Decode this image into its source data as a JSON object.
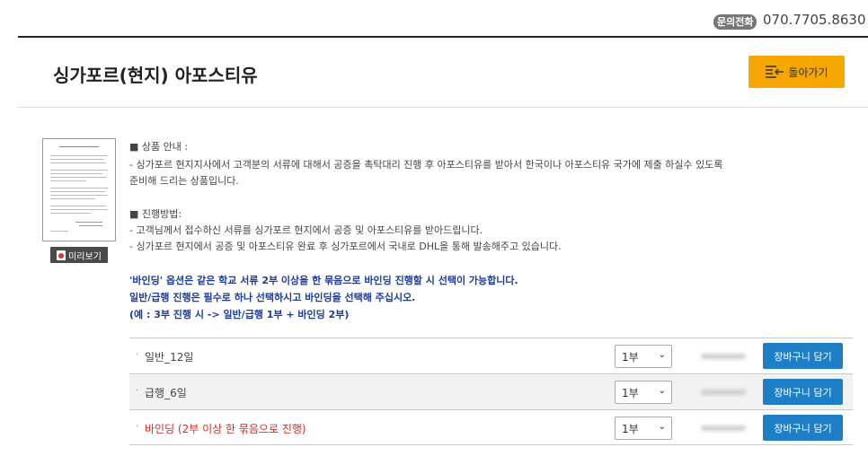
{
  "header": {
    "phone_label": "문의전화",
    "phone_number": "070.7705.8630"
  },
  "page": {
    "title": "싱가포르(현지) 아포스티유",
    "back_button": "돌아가기",
    "preview_button": "미리보기"
  },
  "info": {
    "product_heading": "■ 상품 안내 :",
    "product_line1": "- 싱가포르 현지지사에서 고객분의 서류에 대해서 공증을 촉탁대리 진행 후 아포스티유를 받아서 한국이나 아포스티유 국가에 제출 하실수 있도록",
    "product_line2": "준비해 드리는 상품입니다.",
    "process_heading": "■ 진행방법:",
    "process_line1": "- 고객님께서 접수하신 서류를 싱가포르 현지에서 공증 및 아포스티유를 받아드립니다.",
    "process_line2": "- 싱가포르 현지에서 공증 및 아포스티유 완료 후 싱가포르에서 국내로 DHL을 통해 발송해주고 있습니다.",
    "binding_note1": "'바인딩' 옵션은 같은 학교 서류 2부 이상을 한 묶음으로 바인딩 진행할 시 선택이 가능합니다.",
    "binding_note2": "일반/급행 진행은 필수로 하나 선택하시고 바인딩을 선택해 주십시오.",
    "binding_note3": "(예 : 3부 진행 시 -> 일반/급행 1부 + 바인딩 2부)"
  },
  "options": [
    {
      "name": "일반_12일",
      "quantity": "1부",
      "cart_label": "장바구니 담기"
    },
    {
      "name": "급행_6일",
      "quantity": "1부",
      "cart_label": "장바구니 담기"
    },
    {
      "name": "바인딩 (2부 이상 한 묶음으로 진행)",
      "quantity": "1부",
      "cart_label": "장바구니 담기"
    }
  ],
  "colors": {
    "accent": "#f5a700",
    "cart_button": "#1e7fc6",
    "note_text": "#1a3b9c",
    "binding_text": "#d52a2a"
  }
}
